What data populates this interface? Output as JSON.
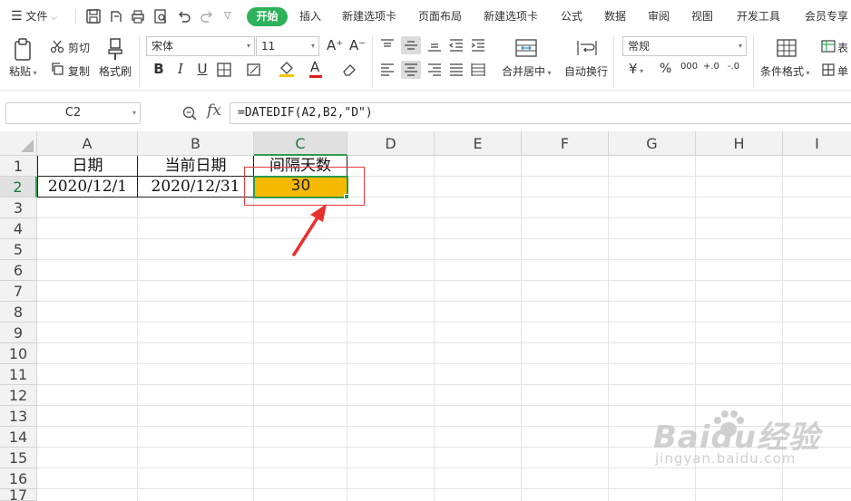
{
  "menubar": {
    "file_label": "文件",
    "tabs": [
      {
        "label": "开始",
        "active": true
      },
      {
        "label": "插入",
        "active": false
      },
      {
        "label": "新建选项卡",
        "active": false
      },
      {
        "label": "页面布局",
        "active": false
      },
      {
        "label": "新建选项卡",
        "active": false
      },
      {
        "label": "公式",
        "active": false
      },
      {
        "label": "数据",
        "active": false
      },
      {
        "label": "审阅",
        "active": false
      },
      {
        "label": "视图",
        "active": false
      },
      {
        "label": "开发工具",
        "active": false
      },
      {
        "label": "会员专享",
        "active": false
      }
    ],
    "accent_color": "#2db15a"
  },
  "ribbon": {
    "paste_label": "粘贴",
    "cut_label": "剪切",
    "copy_label": "复制",
    "format_painter_label": "格式刷",
    "font_name": "宋体",
    "font_size": "11",
    "font_increase": "A⁺",
    "font_decrease": "A⁻",
    "bold": "B",
    "italic": "I",
    "underline": "U",
    "font_color_glyph": "A",
    "merge_label": "合并居中",
    "wrap_label": "自动换行",
    "number_format": "常规",
    "currency": "¥",
    "percent": "%",
    "thousands": "000",
    "dec_increase": "+.0",
    "dec_decrease": "-.0",
    "cond_format_label": "条件格式",
    "table_label": "表",
    "single_label": "单"
  },
  "formula_bar": {
    "cell_ref": "C2",
    "fx": "fx",
    "formula": "=DATEDIF(A2,B2,\"D\")"
  },
  "sheet": {
    "columns": [
      "A",
      "B",
      "C",
      "D",
      "E",
      "F",
      "G",
      "H",
      "I"
    ],
    "rows": [
      "1",
      "2",
      "3",
      "4",
      "5",
      "6",
      "7",
      "8",
      "9",
      "10",
      "11",
      "12",
      "13",
      "14",
      "15",
      "16",
      "17"
    ],
    "active_column": "C",
    "active_row": "2",
    "cells": {
      "A1": "日期",
      "B1": "当前日期",
      "C1": "间隔天数",
      "A2": "2020/12/1",
      "B2": "2020/12/31",
      "C2": "30"
    },
    "selected_fill_color": "#f6b900",
    "selection_border_color": "#2d9b4b",
    "annotation_color": "#e23b3b"
  },
  "watermark": {
    "brand": "Baidu经验",
    "url": "jingyan.baidu.com"
  }
}
